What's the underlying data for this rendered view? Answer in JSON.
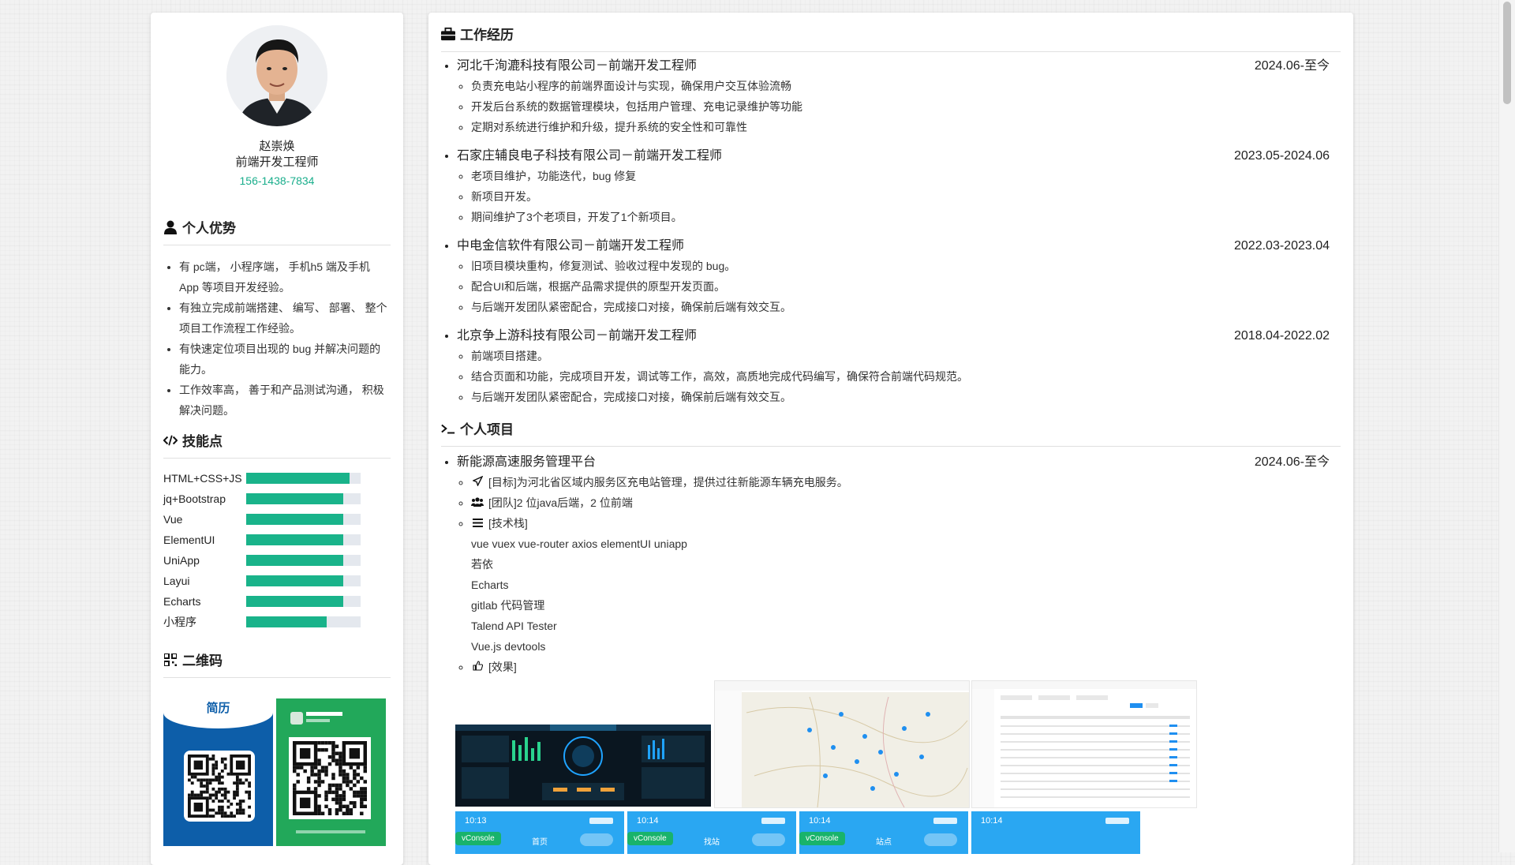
{
  "profile": {
    "name": "赵崇焕",
    "title": "前端开发工程师",
    "phone": "156-1438-7834"
  },
  "advantages": {
    "heading": "个人优势",
    "items": [
      "有 pc端， 小程序端， 手机h5 端及手机 App 等项目开发经验。",
      "有独立完成前端搭建、 编写、 部署、 整个项目工作流程工作经验。",
      "有快速定位项目出现的 bug 并解决问题的能力。",
      "工作效率高， 善于和产品测试沟通， 积极解决问题。"
    ]
  },
  "skills": {
    "heading": "技能点",
    "items": [
      {
        "name": "HTML+CSS+JS",
        "level": 0.9
      },
      {
        "name": "jq+Bootstrap",
        "level": 0.85
      },
      {
        "name": "Vue",
        "level": 0.85
      },
      {
        "name": "ElementUI",
        "level": 0.85
      },
      {
        "name": "UniApp",
        "level": 0.85
      },
      {
        "name": "Layui",
        "level": 0.85
      },
      {
        "name": "Echarts",
        "level": 0.85
      },
      {
        "name": "小程序",
        "level": 0.7
      }
    ],
    "fill_color": "#19b38a"
  },
  "qrcode": {
    "heading": "二维码",
    "resume_label": "简历"
  },
  "work": {
    "heading": "工作经历",
    "jobs": [
      {
        "title": "河北千洵漉科技有限公司－前端开发工程师",
        "date": "2024.06-至今",
        "duties": [
          "负责充电站小程序的前端界面设计与实现，确保用户交互体验流畅",
          "开发后台系统的数据管理模块，包括用户管理、充电记录维护等功能",
          "定期对系统进行维护和升级，提升系统的安全性和可靠性"
        ]
      },
      {
        "title": "石家庄辅良电子科技有限公司－前端开发工程师",
        "date": "2023.05-2024.06",
        "duties": [
          "老项目维护，功能迭代，bug 修复",
          "新项目开发。",
          "期间维护了3个老项目，开发了1个新项目。"
        ]
      },
      {
        "title": "中电金信软件有限公司－前端开发工程师",
        "date": "2022.03-2023.04",
        "duties": [
          "旧项目模块重构，修复测试、验收过程中发现的 bug。",
          "配合UI和后端，根据产品需求提供的原型开发页面。",
          "与后端开发团队紧密配合，完成接口对接，确保前后端有效交互。"
        ]
      },
      {
        "title": "北京争上游科技有限公司－前端开发工程师",
        "date": "2018.04-2022.02",
        "duties": [
          "前端项目搭建。",
          "结合页面和功能，完成项目开发，调试等工作，高效，高质地完成代码编写，确保符合前端代码规范。",
          "与后端开发团队紧密配合，完成接口对接，确保前后端有效交互。"
        ]
      }
    ]
  },
  "projects": {
    "heading": "个人项目",
    "items": [
      {
        "name": "新能源高速服务管理平台",
        "date": "2024.06-至今",
        "goal": "[目标]为河北省区域内服务区充电站管理，提供过往新能源车辆充电服务。",
        "team": "[团队]2 位java后端，2 位前端",
        "stack_label": "[技术栈]",
        "stack": [
          "vue vuex vue-router axios elementUI uniapp",
          "若依",
          "Echarts",
          "gitlab 代码管理",
          "Talend API Tester",
          "Vue.js devtools"
        ],
        "effect_label": "[效果]"
      }
    ]
  },
  "screenshots": {
    "phones": [
      {
        "time": "10:13",
        "badge": "vConsole",
        "title": "首页"
      },
      {
        "time": "10:14",
        "badge": "vConsole",
        "title": "找站"
      },
      {
        "time": "10:14",
        "badge": "vConsole",
        "title": "站点"
      },
      {
        "time": "10:14",
        "badge": "",
        "title": ""
      }
    ]
  }
}
